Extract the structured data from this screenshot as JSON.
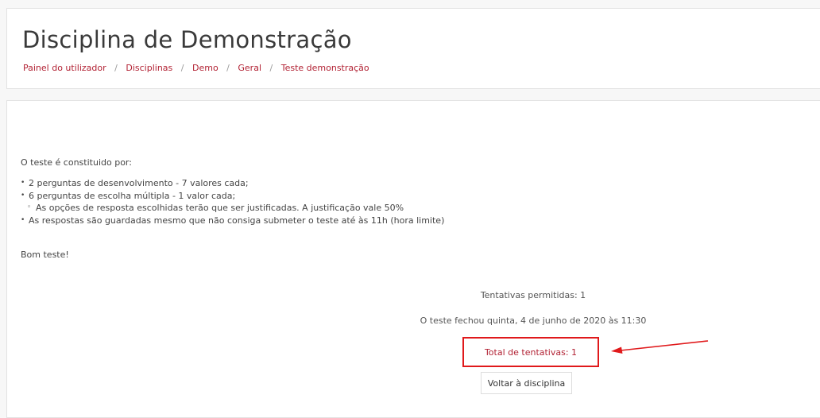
{
  "header": {
    "title": "Disciplina de Demonstração",
    "breadcrumb": [
      "Painel do utilizador",
      "Disciplinas",
      "Demo",
      "Geral",
      "Teste demonstração"
    ],
    "separator": "/"
  },
  "quiz": {
    "intro": "O teste é constituido por:",
    "bullets": [
      "2 perguntas de desenvolvimento  - 7 valores cada;",
      "6 perguntas de escolha múltipla - 1 valor cada;",
      "As opções de resposta escolhidas terão que ser justificadas. A justificação vale 50%",
      "As respostas são guardadas mesmo que não consiga submeter o teste até às 11h (hora limite)"
    ],
    "closing": "Bom teste!",
    "attempts_allowed": "Tentativas permitidas: 1",
    "closed_info": "O teste fechou quinta, 4 de junho de 2020 às 11:30",
    "total_attempts": "Total de tentativas: 1",
    "back_button": "Voltar à disciplina"
  },
  "colors": {
    "link": "#b22234",
    "highlight": "#e0191b"
  }
}
